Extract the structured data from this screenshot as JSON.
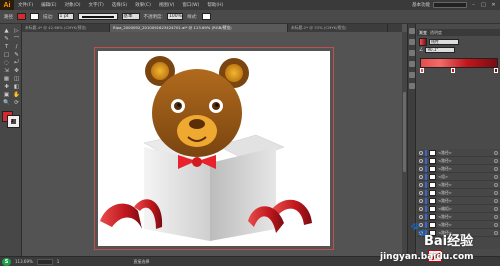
{
  "app": {
    "logo": "Ai"
  },
  "menu": [
    "文件(F)",
    "编辑(E)",
    "对象(O)",
    "文字(T)",
    "选择(S)",
    "效果(C)",
    "视图(V)",
    "窗口(W)",
    "帮助(H)"
  ],
  "workspace": {
    "label": "基本功能"
  },
  "window_controls": {
    "minimize": "–",
    "maximize": "□",
    "close": "✕"
  },
  "options": {
    "selection_label": "路径",
    "fill_color": "#d62a2e",
    "stroke_label": "描边:",
    "stroke_value": "1 pt",
    "brush_label": "基本",
    "opacity_label": "不透明度:",
    "opacity_value": "100%",
    "style_label": "样式:"
  },
  "tabs": [
    {
      "label": "未标题-4* @ 42.66% (CMYK/预览)",
      "active": false
    },
    {
      "label": "Ripa_2000092_2010091623424701.ai* @ 113.69% (RGB/预览)",
      "active": true
    },
    {
      "label": "未标题-2* @ 33% (CMYK/预览)",
      "active": false
    }
  ],
  "tools": [
    "▲",
    "▷",
    "✎",
    "⌒",
    "T",
    "/",
    "□",
    "✎",
    "◌",
    "⤾",
    "⇲",
    "✥",
    "▦",
    "◫",
    "✚",
    "◧",
    "▣",
    "✋",
    "🔍",
    "⟳"
  ],
  "gradient_panel": {
    "tabs": [
      "渐变",
      "透明度"
    ],
    "type_label": "线性",
    "angle_value": "90.1°",
    "bar_colors": [
      "#e84c4c",
      "#c0171d",
      "#7a0c12"
    ]
  },
  "layers": [
    {
      "name": "<路径>"
    },
    {
      "name": "<路径>"
    },
    {
      "name": "<路径>"
    },
    {
      "name": "<组>"
    },
    {
      "name": "<路径>"
    },
    {
      "name": "<路径>"
    },
    {
      "name": "<路径>"
    },
    {
      "name": "<编组>"
    },
    {
      "name": "<路径>"
    },
    {
      "name": "<路径>"
    },
    {
      "name": "<路径>"
    }
  ],
  "status": {
    "logo": "S",
    "zoom": "113.69%",
    "page": "1",
    "tool_name": "直接选择"
  },
  "watermark": {
    "brand": "Bai经验",
    "url": "jingyan.baidu.com"
  }
}
